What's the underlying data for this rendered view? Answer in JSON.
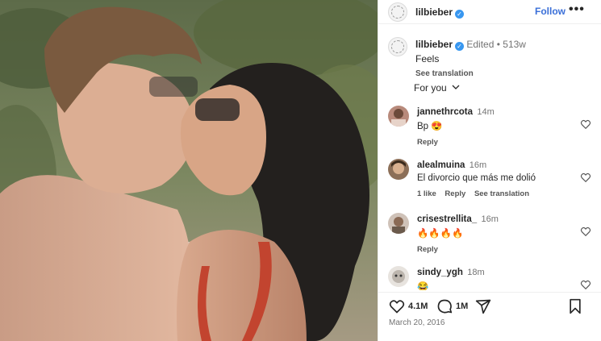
{
  "post": {
    "username": "lilbieber",
    "follow_label": "Follow",
    "more_label": "•••",
    "caption_text": "Feels",
    "edited_label": "Edited",
    "age": "513w",
    "see_translation": "See translation",
    "for_you_label": "For you",
    "date": "March 20, 2016",
    "like_count": "4.1M",
    "comment_count": "1M"
  },
  "comments": [
    {
      "username": "jannethrcota",
      "time": "14m",
      "text": "Bp 😍",
      "actions": [
        "Reply"
      ]
    },
    {
      "username": "alealmuina",
      "time": "16m",
      "text": "El divorcio que más me dolió",
      "actions": [
        "1 like",
        "Reply",
        "See translation"
      ]
    },
    {
      "username": "crisestrellita_",
      "time": "16m",
      "text": "🔥🔥🔥🔥",
      "actions": [
        "Reply"
      ]
    },
    {
      "username": "sindy_ygh",
      "time": "18m",
      "text": "😂",
      "actions": []
    }
  ],
  "icons": [
    "heart-icon",
    "comment-icon",
    "share-icon",
    "bookmark-icon",
    "verified-badge-icon",
    "chevron-down-icon"
  ],
  "colors": {
    "accent": "#3a6fd8",
    "verified": "#3897f0",
    "muted": "#737373"
  }
}
